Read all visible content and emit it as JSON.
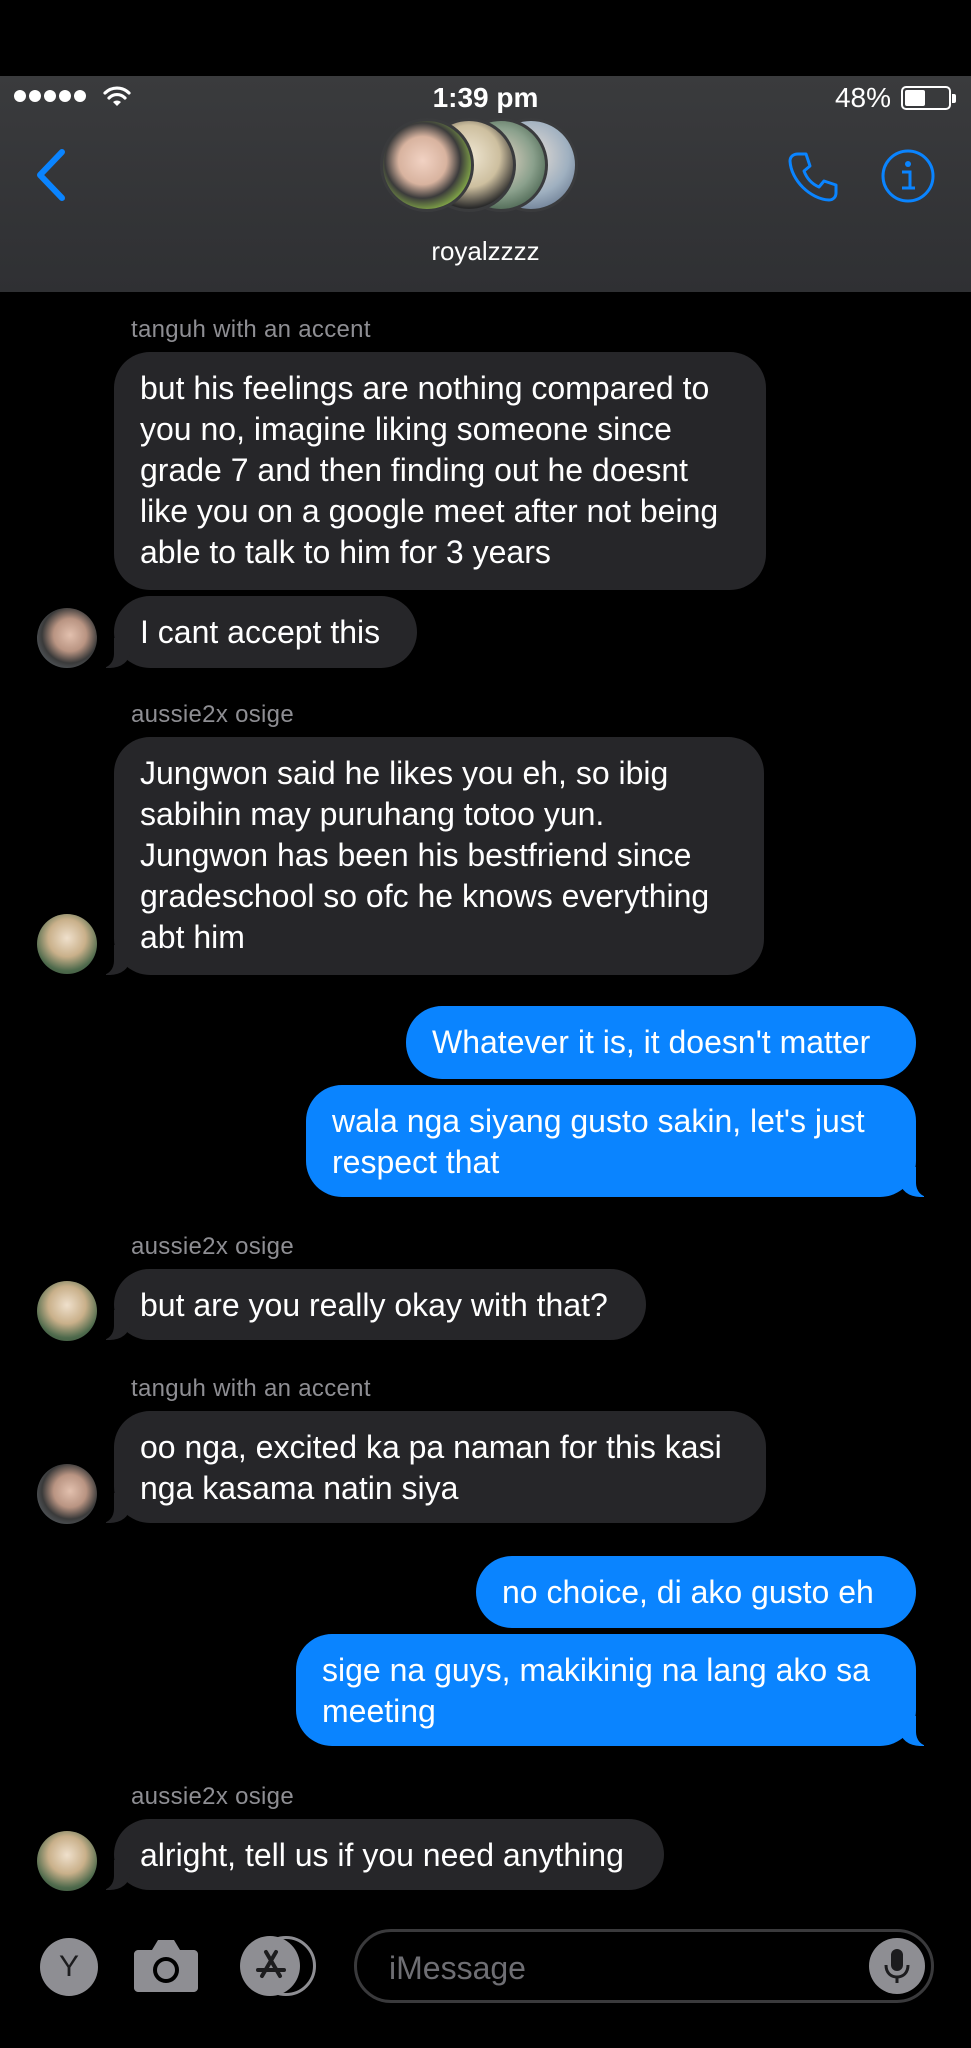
{
  "status_bar": {
    "time": "1:39 pm",
    "battery_percent": "48%",
    "battery_level": 0.48,
    "signal_bars": 5
  },
  "conversation": {
    "group_name": "royalzzzz",
    "participant_avatars": 4
  },
  "icons": {
    "back": "chevron-left-icon",
    "call": "phone-icon",
    "info": "info-icon",
    "camera": "camera-icon",
    "apps": "app-store-icon",
    "dictation": "microphone-icon"
  },
  "colors": {
    "accent": "#0a84ff",
    "incoming_bubble": "#262629",
    "outgoing_bubble": "#0a84ff",
    "sender_label": "#8e8e93",
    "header_bg": "#3a3b3d"
  },
  "messages": [
    {
      "sender": "tanguh with an accent",
      "direction": "in",
      "text": "but his feelings are nothing compared to you no, imagine liking someone since grade 7 and then finding out he doesnt like you on a google meet after not being able to talk to him for 3 years"
    },
    {
      "sender": "tanguh with an accent",
      "direction": "in",
      "text": "I cant accept this"
    },
    {
      "sender": "aussie2x osige",
      "direction": "in",
      "text": "Jungwon said he likes you eh, so ibig sabihin may puruhang totoo yun. Jungwon has been his bestfriend since gradeschool so ofc he knows everything abt him"
    },
    {
      "sender": "",
      "direction": "out",
      "text": "Whatever it is, it doesn't matter"
    },
    {
      "sender": "",
      "direction": "out",
      "text": "wala nga siyang gusto sakin, let's just respect that"
    },
    {
      "sender": "aussie2x osige",
      "direction": "in",
      "text": "but are you really okay with that?"
    },
    {
      "sender": "tanguh with an accent",
      "direction": "in",
      "text": "oo nga, excited ka pa naman for this kasi nga kasama natin siya"
    },
    {
      "sender": "",
      "direction": "out",
      "text": "no choice, di ako gusto eh"
    },
    {
      "sender": "",
      "direction": "out",
      "text": "sige na guys, makikinig na lang ako sa meeting"
    },
    {
      "sender": "aussie2x osige",
      "direction": "in",
      "text": "alright, tell us if you need anything"
    }
  ],
  "composer": {
    "avatar_letter": "Y",
    "placeholder": "iMessage"
  }
}
